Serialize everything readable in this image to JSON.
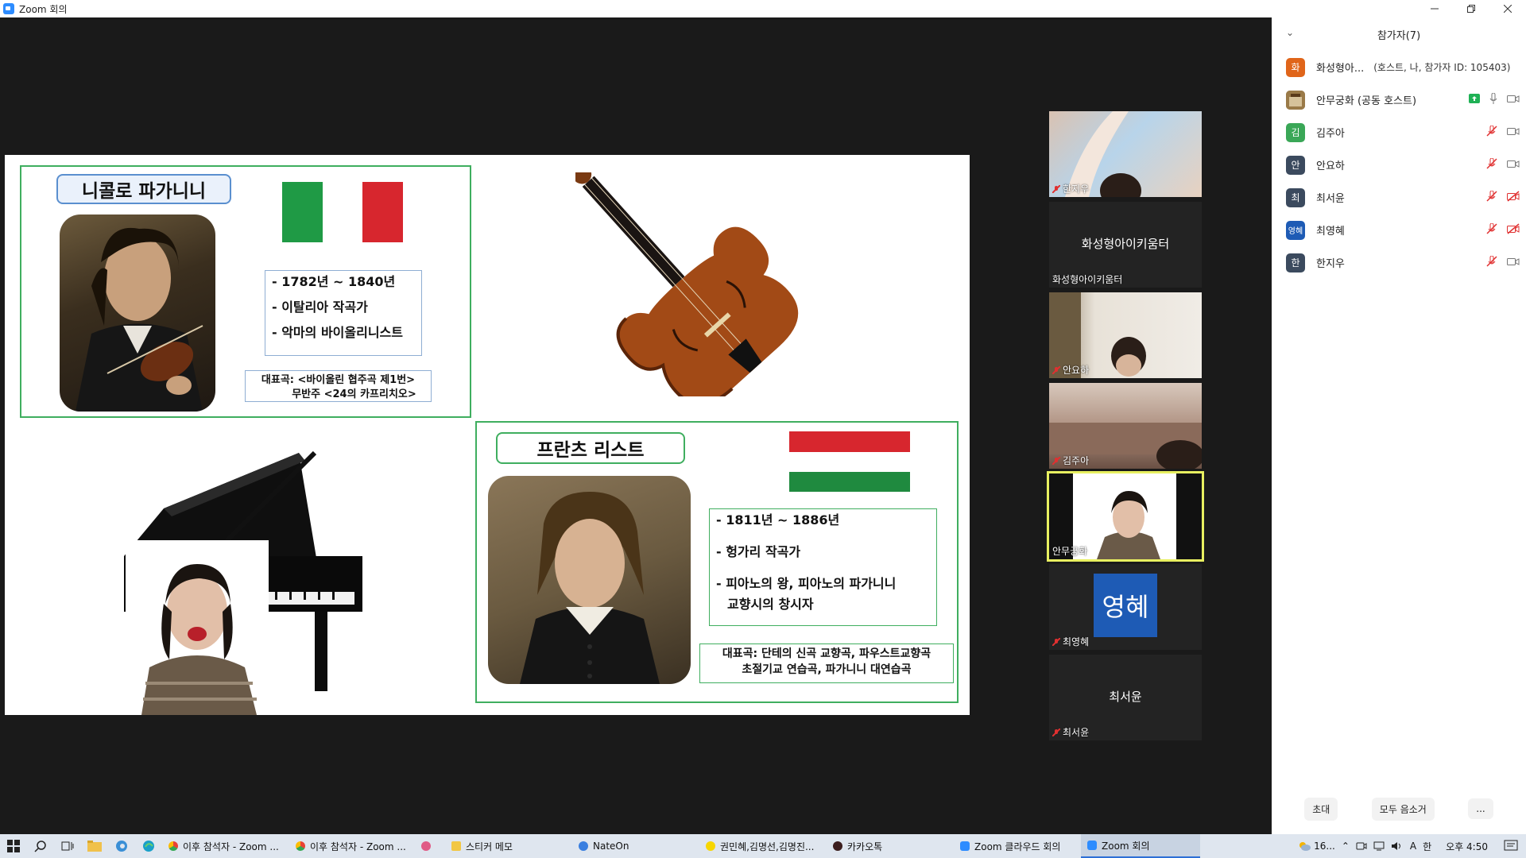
{
  "window": {
    "title": "Zoom 회의"
  },
  "slide": {
    "paganini": {
      "name": "니콜로 파가니니",
      "info": [
        "- 1782년 ~ 1840년",
        "- 이탈리아 작곡가",
        "- 악마의 바이올리니스트"
      ],
      "works_line1": "대표곡: <바이올린 협주곡 제1번>",
      "works_line2": "무반주 <24의 카프리치오>"
    },
    "liszt": {
      "name": "프란츠 리스트",
      "info": [
        "- 1811년 ~ 1886년",
        "- 헝가리 작곡가",
        "- 피아노의 왕, 피아노의 파가니니",
        "교향시의 창시자"
      ],
      "works_line1": "대표곡: 단테의 신곡 교향곡, 파우스트교향곡",
      "works_line2": "초절기교 연습곡, 파가니니 대연습곡"
    }
  },
  "thumbnails": [
    {
      "label": "한지우",
      "center": ""
    },
    {
      "label": "화성형아이키움터",
      "center": "화성형아이키움터"
    },
    {
      "label": "안요하",
      "center": ""
    },
    {
      "label": "김주아",
      "center": ""
    },
    {
      "label": "안무궁화",
      "center": ""
    },
    {
      "label": "최영혜",
      "center": "영혜"
    },
    {
      "label": "최서윤",
      "center": "최서윤"
    }
  ],
  "participants_panel": {
    "title": "참가자(7)",
    "rows": [
      {
        "avatar": "화",
        "name": "화성형아...",
        "role": "(호스트, 나, 참가자 ID: 105403)",
        "color": "#e0651a"
      },
      {
        "avatar": "",
        "name": "안무궁화 (공동 호스트)",
        "role": "",
        "color": "#8a6a3a"
      },
      {
        "avatar": "김",
        "name": "김주아",
        "role": "",
        "color": "#3aa757"
      },
      {
        "avatar": "안",
        "name": "안요하",
        "role": "",
        "color": "#3b4a5e"
      },
      {
        "avatar": "최",
        "name": "최서윤",
        "role": "",
        "color": "#3b4a5e"
      },
      {
        "avatar": "영혜",
        "name": "최영혜",
        "role": "",
        "color": "#1e5bb5"
      },
      {
        "avatar": "한",
        "name": "한지우",
        "role": "",
        "color": "#3b4a5e"
      }
    ],
    "footer": {
      "invite": "초대",
      "mute_all": "모두 음소거",
      "more": "..."
    }
  },
  "taskbar": {
    "apps": [
      {
        "label": "이후 참석자 - Zoom ...",
        "icon": "chrome-icon",
        "color": "#e94235"
      },
      {
        "label": "이후 참석자 - Zoom ...",
        "icon": "chrome-icon",
        "color": "#e94235"
      },
      {
        "label": "",
        "icon": "app-icon",
        "color": "#e05b86"
      },
      {
        "label": "스티커 메모",
        "icon": "sticky-notes-icon",
        "color": "#f2c744"
      },
      {
        "label": "NateOn",
        "icon": "nateon-icon",
        "color": "#3a7fe0"
      },
      {
        "label": "권민혜,김명선,김명진...",
        "icon": "kakao-icon",
        "color": "#f7d600"
      },
      {
        "label": "카카오톡",
        "icon": "kakaotalk-icon",
        "color": "#3c1e1e"
      },
      {
        "label": "Zoom 클라우드 회의",
        "icon": "zoom-icon",
        "color": "#2d8cff"
      },
      {
        "label": "Zoom 회의",
        "icon": "zoom-icon",
        "color": "#2d8cff"
      }
    ],
    "weather": "16...",
    "ime1": "A",
    "ime2": "한",
    "clock": "오후 4:50"
  }
}
